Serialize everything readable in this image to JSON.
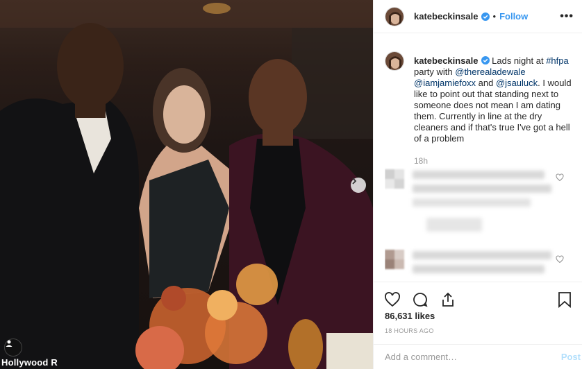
{
  "post": {
    "photo_credit": "Hollywood R",
    "author": {
      "username": "katebeckinsale",
      "verified": true
    },
    "header": {
      "separator": "•",
      "follow_label": "Follow",
      "more_label": "•••"
    },
    "caption": {
      "username": "katebeckinsale",
      "text_1": " Lads night at ",
      "hashtag": "#hfpa",
      "text_2": " party with ",
      "mention_1": "@therealadewale",
      "mention_2": "@iamjamiefoxx",
      "text_3": " and ",
      "mention_3": "@jsauluck",
      "text_4": ". I would like to point out that standing next to someone does not mean I am dating them. Currently in line at the dry cleaners and if that's true I've got a hell of a problem",
      "time": "18h"
    },
    "likes": "86,631 likes",
    "posted": "18 HOURS AGO",
    "comment_box": {
      "placeholder": "Add a comment…",
      "post_label": "Post"
    }
  },
  "icons": {
    "verified": "verified-badge-icon",
    "more": "more-options-icon",
    "like": "heart-icon",
    "comment": "comment-icon",
    "share": "share-icon",
    "save": "bookmark-icon",
    "next": "chevron-right-icon"
  },
  "colors": {
    "link": "#003569",
    "follow": "#3897f0",
    "verified": "#3897f0",
    "muted": "#999999"
  }
}
